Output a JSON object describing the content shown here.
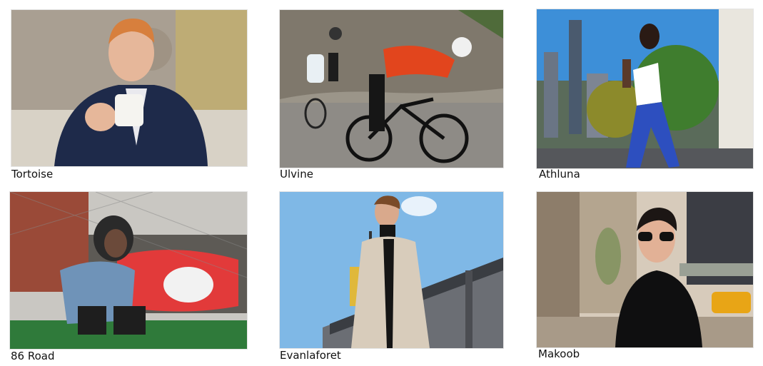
{
  "gallery": {
    "items": [
      {
        "label": "Tortoise"
      },
      {
        "label": "Ulvine"
      },
      {
        "label": "Athluna"
      },
      {
        "label": "86 Road"
      },
      {
        "label": "Evanlaforet"
      },
      {
        "label": "Makoob"
      }
    ]
  }
}
